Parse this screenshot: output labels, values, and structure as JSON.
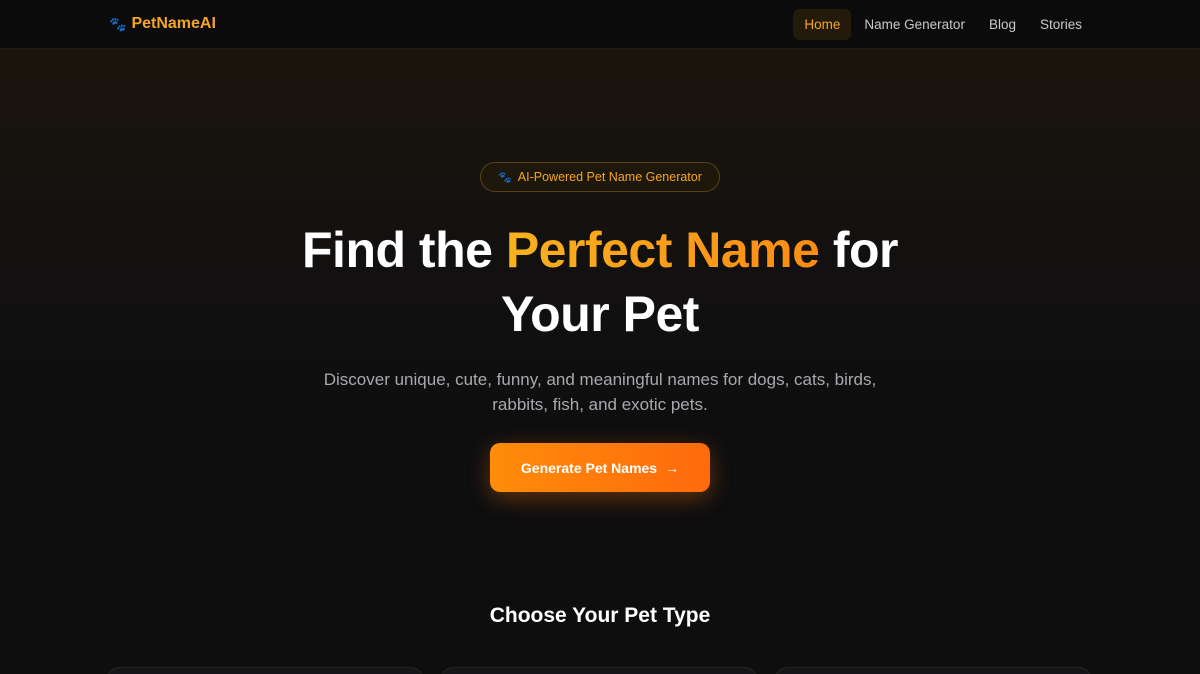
{
  "brand": {
    "name": "PetNameAI",
    "icon": "paw-icon"
  },
  "nav": {
    "items": [
      {
        "label": "Home",
        "active": true
      },
      {
        "label": "Name Generator",
        "active": false
      },
      {
        "label": "Blog",
        "active": false
      },
      {
        "label": "Stories",
        "active": false
      }
    ]
  },
  "hero": {
    "badge": {
      "icon": "paw-icon",
      "label": "AI-Powered Pet Name Generator"
    },
    "headline": {
      "part1": "Find the ",
      "accent": "Perfect Name",
      "part2": " for",
      "line2": "Your Pet"
    },
    "subtext": "Discover unique, cute, funny, and meaningful names for dogs, cats, birds, rabbits, fish, and exotic pets.",
    "cta": {
      "label": "Generate Pet Names",
      "icon": "arrow-right-icon"
    }
  },
  "pet_types": {
    "title": "Choose Your Pet Type"
  },
  "colors": {
    "accent": "#f5a524",
    "cta_start": "#ff8c0a",
    "cta_end": "#ff6a0c",
    "background": "#0e0e0f"
  }
}
